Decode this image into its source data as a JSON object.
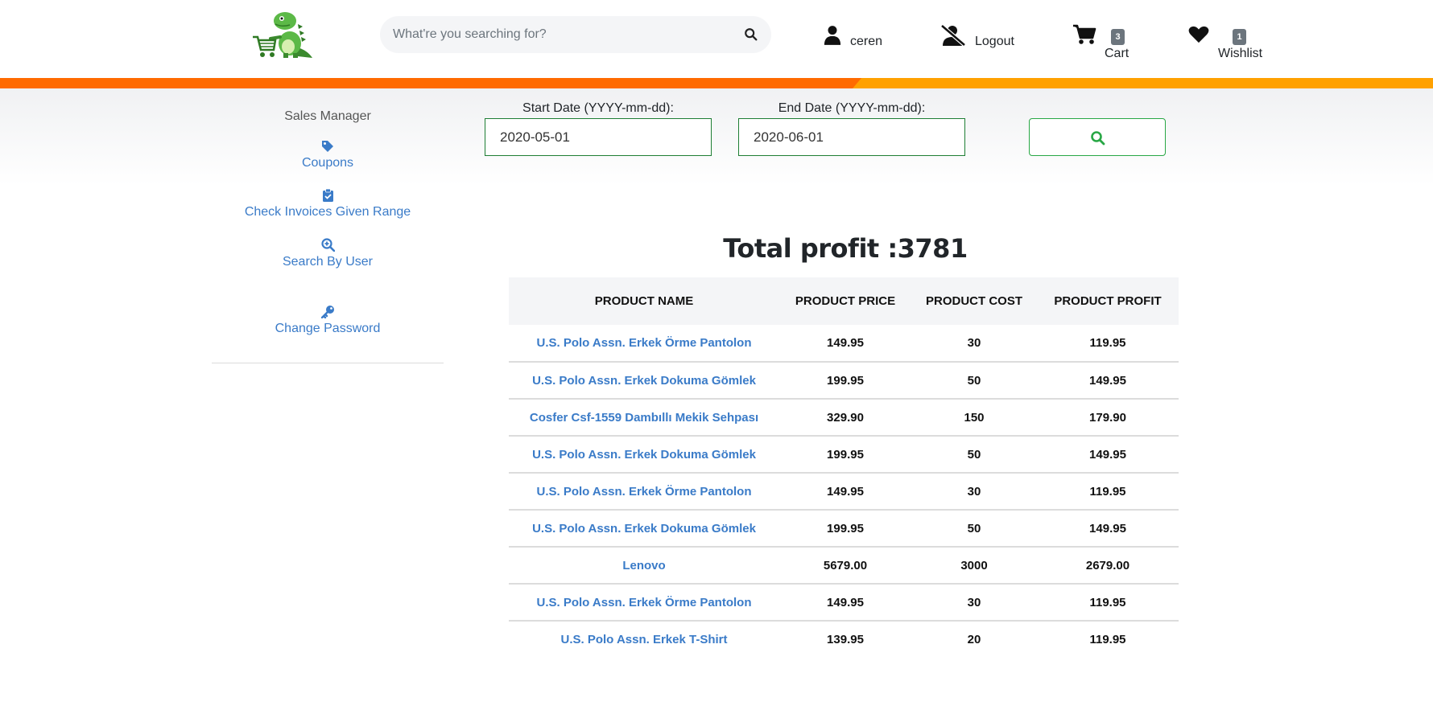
{
  "search": {
    "placeholder": "What're you searching for?"
  },
  "header": {
    "user_label": "ceren",
    "logout_label": "Logout",
    "cart_label": "Cart",
    "cart_count": "3",
    "wishlist_label": "Wishlist",
    "wishlist_count": "1"
  },
  "colors": {
    "accent_orange": "#ff6a00",
    "accent_amber": "#ffa100",
    "link_blue": "#3a7bc8",
    "success_green": "#28a745"
  },
  "sidebar": {
    "title": "Sales Manager",
    "items": [
      {
        "label": "Coupons",
        "icon": "tag-icon"
      },
      {
        "label": "Check Invoices Given Range",
        "icon": "clipboard-check-icon"
      },
      {
        "label": "Search By User",
        "icon": "search-plus-icon"
      },
      {
        "label": "Change Password",
        "icon": "key-icon"
      }
    ]
  },
  "filters": {
    "start_label": "Start Date (YYYY-mm-dd):",
    "start_value": "2020-05-01",
    "end_label": "End Date (YYYY-mm-dd):",
    "end_value": "2020-06-01"
  },
  "total": {
    "label": "Total profit :3781"
  },
  "table": {
    "headers": [
      "PRODUCT NAME",
      "PRODUCT PRICE",
      "PRODUCT COST",
      "PRODUCT PROFIT"
    ],
    "rows": [
      [
        "U.S. Polo Assn. Erkek Örme Pantolon",
        "149.95",
        "30",
        "119.95"
      ],
      [
        "U.S. Polo Assn. Erkek Dokuma Gömlek",
        "199.95",
        "50",
        "149.95"
      ],
      [
        "Cosfer Csf-1559 Dambıllı Mekik Sehpası",
        "329.90",
        "150",
        "179.90"
      ],
      [
        "U.S. Polo Assn. Erkek Dokuma Gömlek",
        "199.95",
        "50",
        "149.95"
      ],
      [
        "U.S. Polo Assn. Erkek Örme Pantolon",
        "149.95",
        "30",
        "119.95"
      ],
      [
        "U.S. Polo Assn. Erkek Dokuma Gömlek",
        "199.95",
        "50",
        "149.95"
      ],
      [
        "Lenovo",
        "5679.00",
        "3000",
        "2679.00"
      ],
      [
        "U.S. Polo Assn. Erkek Örme Pantolon",
        "149.95",
        "30",
        "119.95"
      ],
      [
        "U.S. Polo Assn. Erkek T-Shirt",
        "139.95",
        "20",
        "119.95"
      ]
    ]
  }
}
